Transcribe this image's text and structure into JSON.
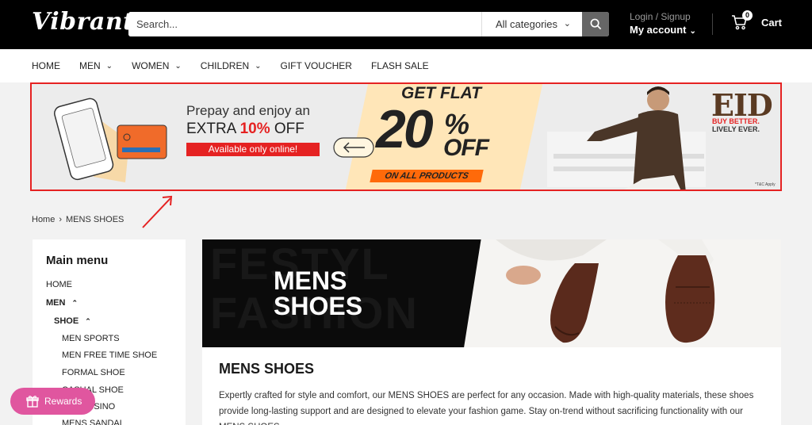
{
  "header": {
    "logo": "Vibrant",
    "search_placeholder": "Search...",
    "category": "All categories",
    "login_signup": "Login / Signup",
    "my_account": "My account",
    "cart_count": "0",
    "cart_label": "Cart"
  },
  "nav": {
    "items": [
      {
        "label": "HOME",
        "dropdown": false
      },
      {
        "label": "MEN",
        "dropdown": true
      },
      {
        "label": "WOMEN",
        "dropdown": true
      },
      {
        "label": "CHILDREN",
        "dropdown": true
      },
      {
        "label": "GIFT VOUCHER",
        "dropdown": false
      },
      {
        "label": "FLASH SALE",
        "dropdown": false
      }
    ]
  },
  "banner": {
    "prepay": "Prepay and enjoy an",
    "extra_prefix": "EXTRA",
    "extra_pct": "10%",
    "extra_suffix": "OFF",
    "online": "Available only online!",
    "get_flat": "GET FLAT",
    "big_number": "20",
    "percent": "%",
    "off": "OFF",
    "all_products": "ON ALL PRODUCTS",
    "eid": "EID",
    "buy_better": "BUY BETTER.",
    "lively_ever": "LIVELY EVER.",
    "tnc": "*T&C Apply"
  },
  "breadcrumb": {
    "home": "Home",
    "sep": "›",
    "current": "MENS SHOES"
  },
  "sidebar": {
    "title": "Main menu",
    "items": {
      "home": "HOME",
      "men": "MEN",
      "shoe": "SHOE",
      "men_sports": "MEN SPORTS",
      "men_free_time": "MEN FREE TIME SHOE",
      "formal": "FORMAL SHOE",
      "casual": "CASUAL SHOE",
      "mocassino": "MOCASSINO",
      "mens_sandal": "MENS SANDAL"
    }
  },
  "hero": {
    "watermark_line1": "FESTYL",
    "watermark_line2": "FASHION",
    "title_line1": "MENS",
    "title_line2": "SHOES"
  },
  "content": {
    "title": "MENS SHOES",
    "description": "Expertly crafted for style and comfort, our MENS SHOES are perfect for any occasion. Made with high-quality materials, these shoes provide long-lasting support and are designed to elevate your fashion game. Stay on-trend without sacrificing functionality with our MENS SHOES."
  },
  "rewards": {
    "label": "Rewards"
  },
  "colors": {
    "accent_red": "#e52222",
    "rewards_pink": "#e0569f",
    "orange": "#ff6a0a",
    "header_bg": "#000000"
  }
}
